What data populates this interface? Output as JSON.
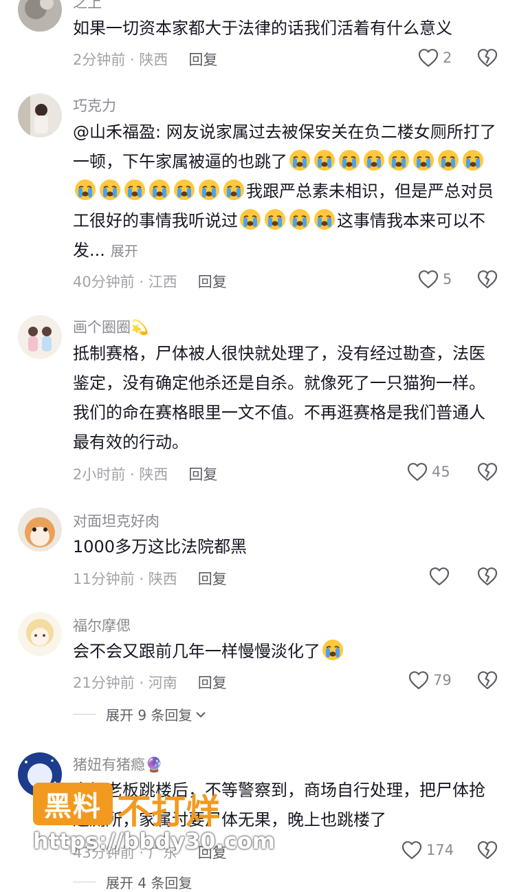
{
  "comments": [
    {
      "name": "之上",
      "text": "如果一切资本家都大于法律的话我们活着有什么意义",
      "time_loc": "2分钟前 · 陕西",
      "reply": "回复",
      "likes": "2"
    },
    {
      "name": "巧克力",
      "text_parts": [
        "@山禾福盈: 网友说家属过去被保安关在负二楼女厕所打了一顿，下午家属被逼的也跳了",
        "我跟严总素未相识，但是严总对员工很好的事情我听说过",
        "这事情我本来可以不发..."
      ],
      "expand": "展开",
      "time_loc": "40分钟前 · 江西",
      "reply": "回复",
      "likes": "5"
    },
    {
      "name": "画个圈圈",
      "name_emoji": "💫",
      "text": "抵制赛格，尸体被人很快就处理了，没有经过勘查，法医鉴定，没有确定他杀还是自杀。就像死了一只猫狗一样。我们的命在赛格眼里一文不值。不再逛赛格是我们普通人最有效的行动。",
      "time_loc": "2小时前 · 陕西",
      "reply": "回复",
      "likes": "45"
    },
    {
      "name": "对面坦克好肉",
      "text": "1000多万这比法院都黑",
      "time_loc": "11分钟前 · 陕西",
      "reply": "回复",
      "likes": ""
    },
    {
      "name": "福尔摩偲",
      "text": "会不会又跟前几年一样慢慢淡化了",
      "time_loc": "21分钟前 · 河南",
      "reply": "回复",
      "likes": "79",
      "more_replies": "展开 9 条回复"
    },
    {
      "name": "猪妞有猪瘾",
      "name_emoji": "🔮",
      "text": "商场老板跳楼后，不等警察到，商场自行处理，把尸体抢进厕所，家属讨要尸体无果，晚上也跳楼了",
      "time_loc": "43分钟前 · 广东",
      "reply": "回复",
      "likes": "174",
      "more_replies": "展开 4 条回复"
    }
  ],
  "watermark": {
    "badge": "黑料",
    "title": "不打烊",
    "url": "https://bbdy30.com"
  },
  "colors": {
    "name": "#8a8b91",
    "text": "#161823",
    "meta": "#a2a3a8",
    "watermark": "#f29a1f"
  },
  "icons": [
    "heart-outline-icon",
    "dislike-heart-icon",
    "crying-emoji",
    "chevron-down-icon"
  ]
}
